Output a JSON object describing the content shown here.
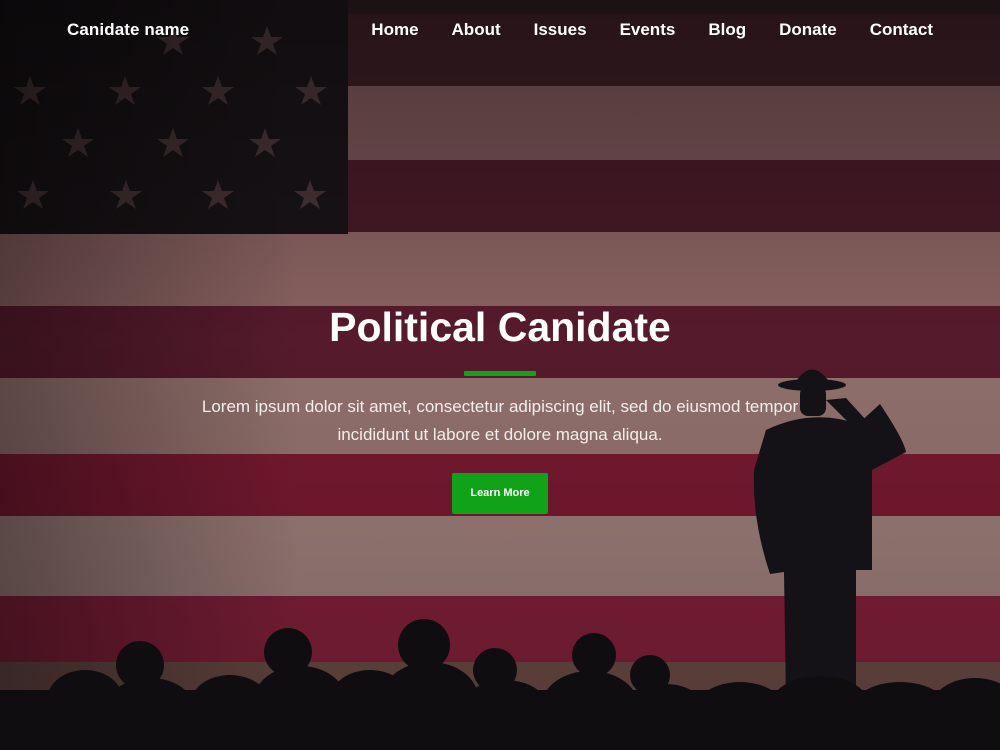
{
  "nav": {
    "brand": "Canidate name",
    "items": [
      {
        "label": "Home"
      },
      {
        "label": "About"
      },
      {
        "label": "Issues"
      },
      {
        "label": "Events"
      },
      {
        "label": "Blog"
      },
      {
        "label": "Donate"
      },
      {
        "label": "Contact"
      }
    ]
  },
  "hero": {
    "title": "Political Canidate",
    "description": "Lorem ipsum dolor sit amet, consectetur adipiscing elit, sed do eiusmod tempor incididunt ut labore et dolore magna aliqua.",
    "button_label": "Learn More"
  },
  "colors": {
    "accent": "#10a31a",
    "text": "#ffffff"
  }
}
